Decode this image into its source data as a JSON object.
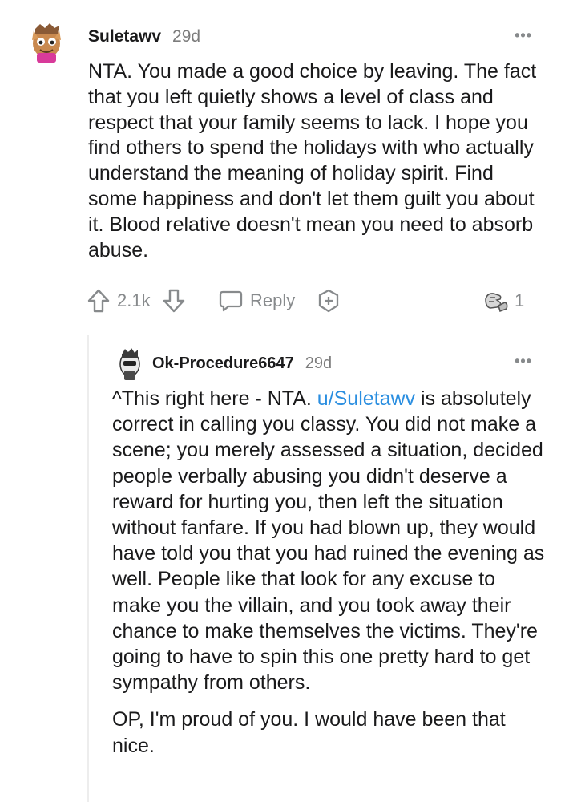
{
  "comment": {
    "author": "Suletawv",
    "age": "29d",
    "more_label": "•••",
    "body": "NTA. You made a good choice by leaving. The fact that you left quietly shows a level of class and respect that your family seems to lack. I hope you find others to spend the holidays with who actually understand the meaning of holiday spirit. Find some happiness and don't let them guilt you about it. Blood relative doesn't mean you need to absorb abuse.",
    "score": "2.1k",
    "reply_label": "Reply",
    "award_count": "1",
    "icons": {
      "upvote": "arrow-up-icon",
      "downvote": "arrow-down-icon",
      "reply": "speech-bubble-icon",
      "award": "plus-circle-icon",
      "award_given": "fist-bump-award-icon"
    }
  },
  "reply": {
    "author": "Ok-Procedure6647",
    "age": "29d",
    "more_label": "•••",
    "body_prefix": "^This right here - NTA. ",
    "user_link": "u/Suletawv",
    "body_rest": " is absolutely correct in calling you classy. You did not make a scene; you merely assessed a situation, decided people verbally abusing you didn't deserve a reward for hurting you, then left the situation without fanfare. If you had blown up, they would have told you that you had ruined the evening as well. People like that look for any excuse to make you the villain, and you took away their chance to make themselves the victims. They're going to have to spin this one pretty hard to get sympathy from others.",
    "body_p2": "OP, I'm proud of you. I would have been that nice."
  },
  "colors": {
    "text": "#1a1a1b",
    "meta": "#7c7c7c",
    "icon": "#878a8c",
    "link": "#2a8ee0",
    "thread_line": "#ededed"
  }
}
